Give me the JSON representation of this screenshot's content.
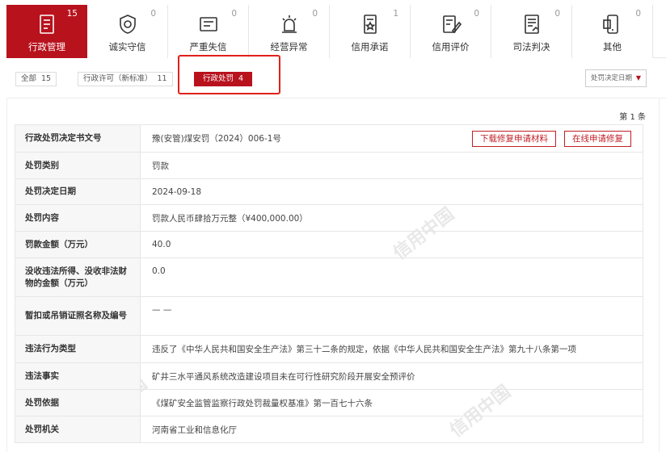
{
  "categories": [
    {
      "label": "行政管理",
      "count": "15",
      "icon": "document-list-icon",
      "active": true
    },
    {
      "label": "诚实守信",
      "count": "0",
      "icon": "shield-badge-icon",
      "active": false
    },
    {
      "label": "严重失信",
      "count": "0",
      "icon": "dishonest-person-card-icon",
      "active": false
    },
    {
      "label": "经营异常",
      "count": "0",
      "icon": "alarm-beacon-icon",
      "active": false
    },
    {
      "label": "信用承诺",
      "count": "1",
      "icon": "promise-scroll-icon",
      "active": false
    },
    {
      "label": "信用评价",
      "count": "0",
      "icon": "evaluation-edit-icon",
      "active": false
    },
    {
      "label": "司法判决",
      "count": "0",
      "icon": "judgment-document-icon",
      "active": false
    },
    {
      "label": "其他",
      "count": "0",
      "icon": "other-app-icon",
      "active": false
    }
  ],
  "sub_filters": [
    {
      "label": "全部",
      "count": "15"
    },
    {
      "label": "行政许可（新标准）",
      "count": "11"
    },
    {
      "label": "行政处罚",
      "count": "4",
      "active": true
    }
  ],
  "sort_select": {
    "value": "处罚决定日期"
  },
  "page_info": "第 1 条",
  "buttons": {
    "download": "下载修复申请材料",
    "online_repair": "在线申请修复"
  },
  "watermark_text": "信用中国",
  "detail_rows": [
    {
      "key": "行政处罚决定书文号",
      "value": "豫(安管)煤安罚（2024）006-1号"
    },
    {
      "key": "处罚类别",
      "value": "罚款"
    },
    {
      "key": "处罚决定日期",
      "value": "2024-09-18"
    },
    {
      "key": "处罚内容",
      "value": "罚款人民币肆拾万元整（¥400,000.00）"
    },
    {
      "key": "罚款金额（万元）",
      "value": "40.0"
    },
    {
      "key": "没收违法所得、没收非法财物的金额（万元）",
      "value": "0.0"
    },
    {
      "key": "暂扣或吊销证照名称及编号",
      "value": "— —"
    },
    {
      "key": "违法行为类型",
      "value": "违反了《中华人民共和国安全生产法》第三十二条的规定，依据《中华人民共和国安全生产法》第九十八条第一项"
    },
    {
      "key": "违法事实",
      "value": "矿井三水平通风系统改造建设项目未在可行性研究阶段开展安全预评价"
    },
    {
      "key": "处罚依据",
      "value": "《煤矿安全监管监察行政处罚裁量权基准》第一百七十六条"
    },
    {
      "key": "处罚机关",
      "value": "河南省工业和信息化厅"
    }
  ]
}
